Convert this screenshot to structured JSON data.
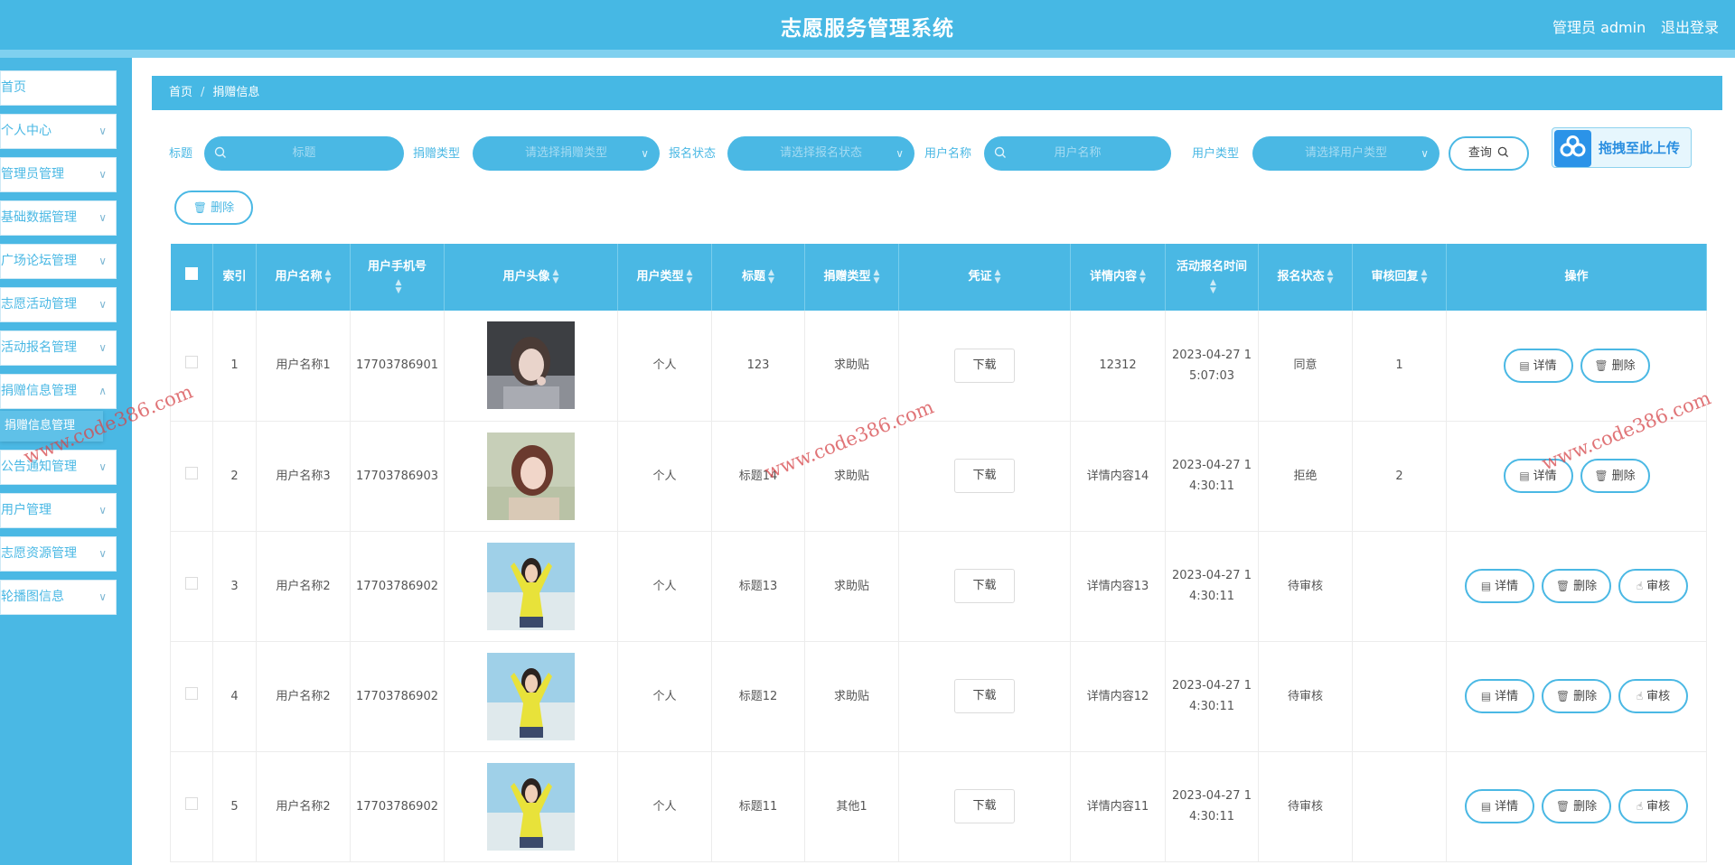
{
  "header": {
    "title": "志愿服务管理系统",
    "admin": "管理员 admin",
    "logout": "退出登录"
  },
  "sidebar": {
    "items": [
      {
        "label": "首页",
        "chevron": false
      },
      {
        "label": "个人中心",
        "chevron": true
      },
      {
        "label": "管理员管理",
        "chevron": true
      },
      {
        "label": "基础数据管理",
        "chevron": true
      },
      {
        "label": "广场论坛管理",
        "chevron": true
      },
      {
        "label": "志愿活动管理",
        "chevron": true
      },
      {
        "label": "活动报名管理",
        "chevron": true
      },
      {
        "label": "捐赠信息管理",
        "chevron": true
      },
      {
        "label": "公告通知管理",
        "chevron": true
      },
      {
        "label": "用户管理",
        "chevron": true
      },
      {
        "label": "志愿资源管理",
        "chevron": true
      },
      {
        "label": "轮播图信息",
        "chevron": true
      }
    ],
    "sub_item": "捐赠信息管理"
  },
  "breadcrumb": {
    "home": "首页",
    "sep": "/",
    "current": "捐赠信息"
  },
  "filters": {
    "title_label": "标题",
    "title_placeholder": "标题",
    "donation_type_label": "捐赠类型",
    "donation_type_placeholder": "请选择捐赠类型",
    "apply_status_label": "报名状态",
    "apply_status_placeholder": "请选择报名状态",
    "user_name_label": "用户名称",
    "user_name_placeholder": "用户名称",
    "user_type_label": "用户类型",
    "user_type_placeholder": "请选择用户类型",
    "query_button": "查询",
    "upload_text": "拖拽至此上传",
    "delete_button": "删除"
  },
  "table": {
    "headers": {
      "index": "索引",
      "user_name": "用户名称",
      "phone": "用户手机号",
      "avatar": "用户头像",
      "user_type": "用户类型",
      "title": "标题",
      "donation_type": "捐赠类型",
      "voucher": "凭证",
      "detail": "详情内容",
      "apply_time": "活动报名时间",
      "status": "报名状态",
      "reply": "审核回复",
      "actions": "操作"
    },
    "rows": [
      {
        "index": "1",
        "user_name": "用户名称1",
        "phone": "17703786901",
        "avatar": "photo-woman-gray-hoodie",
        "user_type": "个人",
        "title": "123",
        "donation_type": "求助贴",
        "voucher": "下载",
        "detail": "12312",
        "time1": "2023-04-27 1",
        "time2": "5:07:03",
        "status": "同意",
        "reply": "1",
        "actions": [
          "详情",
          "删除"
        ]
      },
      {
        "index": "2",
        "user_name": "用户名称3",
        "phone": "17703786903",
        "avatar": "photo-woman-flower-field",
        "user_type": "个人",
        "title": "标题14",
        "donation_type": "求助贴",
        "voucher": "下载",
        "detail": "详情内容14",
        "time1": "2023-04-27 1",
        "time2": "4:30:11",
        "status": "拒绝",
        "reply": "2",
        "actions": [
          "详情",
          "删除"
        ]
      },
      {
        "index": "3",
        "user_name": "用户名称2",
        "phone": "17703786902",
        "avatar": "photo-woman-yellow-sweater",
        "user_type": "个人",
        "title": "标题13",
        "donation_type": "求助贴",
        "voucher": "下载",
        "detail": "详情内容13",
        "time1": "2023-04-27 1",
        "time2": "4:30:11",
        "status": "待审核",
        "reply": "",
        "actions": [
          "详情",
          "删除",
          "审核"
        ]
      },
      {
        "index": "4",
        "user_name": "用户名称2",
        "phone": "17703786902",
        "avatar": "photo-woman-yellow-sweater",
        "user_type": "个人",
        "title": "标题12",
        "donation_type": "求助贴",
        "voucher": "下载",
        "detail": "详情内容12",
        "time1": "2023-04-27 1",
        "time2": "4:30:11",
        "status": "待审核",
        "reply": "",
        "actions": [
          "详情",
          "删除",
          "审核"
        ]
      },
      {
        "index": "5",
        "user_name": "用户名称2",
        "phone": "17703786902",
        "avatar": "photo-woman-yellow-sweater",
        "user_type": "个人",
        "title": "标题11",
        "donation_type": "其他1",
        "voucher": "下载",
        "detail": "详情内容11",
        "time1": "2023-04-27 1",
        "time2": "4:30:11",
        "status": "待审核",
        "reply": "",
        "actions": [
          "详情",
          "删除",
          "审核"
        ]
      }
    ]
  },
  "watermark": "www.code386.com",
  "colors": {
    "primary": "#4ab8e4",
    "header": "#46b8e4",
    "upload_blue": "#2b93e8"
  }
}
